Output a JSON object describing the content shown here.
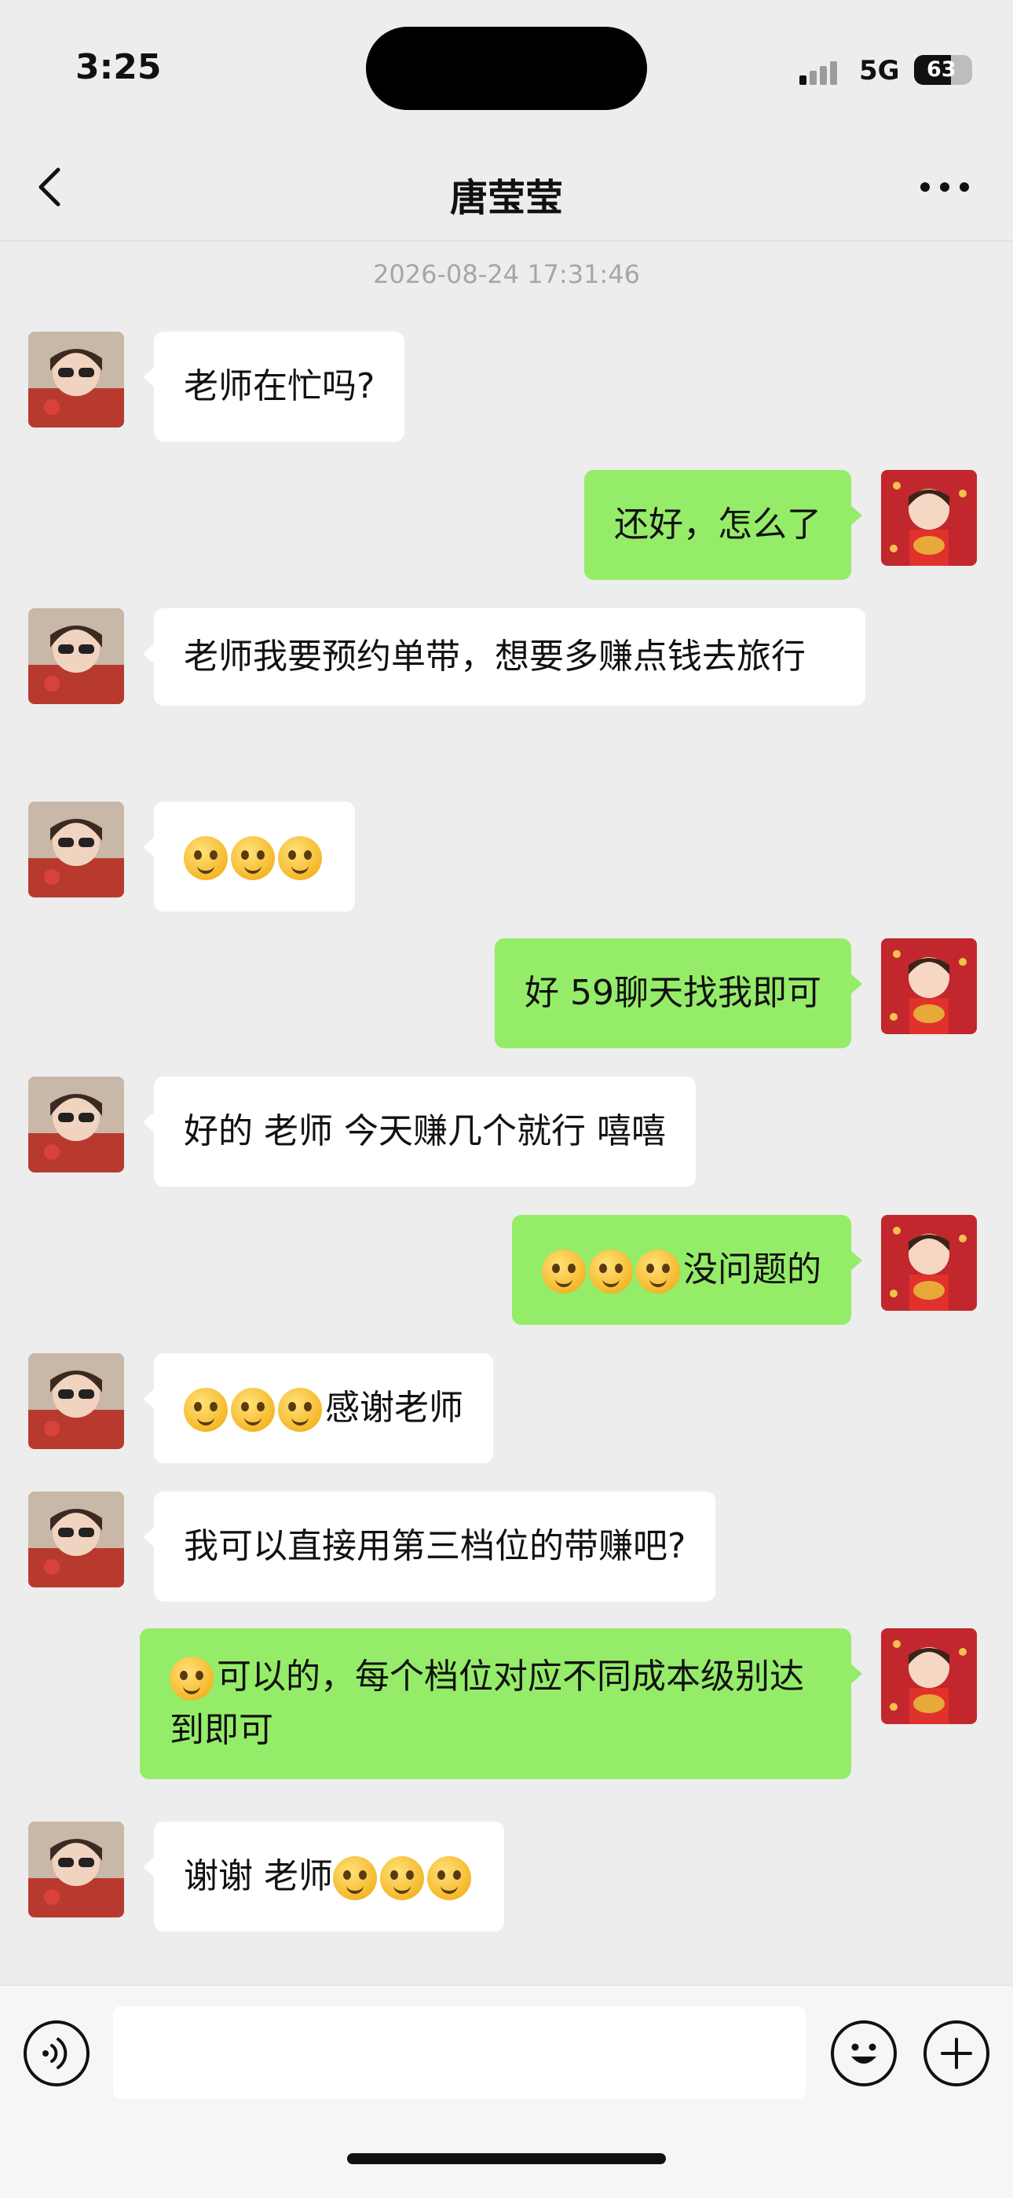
{
  "status_bar": {
    "time": "3:25",
    "network": "5G",
    "battery_percent": 63,
    "battery_label": "63",
    "signal_bars": 4
  },
  "nav": {
    "title": "唐莹莹",
    "back_icon": "chevron-left-icon",
    "more_icon": "more-dots-icon"
  },
  "chat": {
    "timestamp": "2026-08-24 17:31:46",
    "messages": [
      {
        "side": "in",
        "text": "老师在忙吗?"
      },
      {
        "side": "out",
        "text": "还好，怎么了"
      },
      {
        "side": "in",
        "text": "老师我要预约单带，想要多赚点钱去旅行"
      },
      {
        "side": "in",
        "emoji": "salute-face-emoji",
        "emoji_count": 3,
        "text": ""
      },
      {
        "side": "out",
        "text": "好 59聊天找我即可"
      },
      {
        "side": "in",
        "text": "好的 老师 今天赚几个就行 嘻嘻"
      },
      {
        "side": "out",
        "emoji": "smirk-face-emoji",
        "emoji_count": 3,
        "text": "没问题的"
      },
      {
        "side": "in",
        "emoji": "fighting-face-emoji",
        "emoji_count": 3,
        "text": "感谢老师"
      },
      {
        "side": "in",
        "text": "我可以直接用第三档位的带赚吧?"
      },
      {
        "side": "out",
        "emoji": "ok-hand-emoji",
        "emoji_count": 1,
        "text": "可以的，每个档位对应不同成本级别达到即可"
      },
      {
        "side": "in",
        "text": "谢谢 老师",
        "emoji_after": "grin-face-emoji",
        "emoji_after_count": 3
      }
    ]
  },
  "input_bar": {
    "voice_icon": "voice-icon",
    "emoji_icon": "emoji-face-icon",
    "plus_icon": "plus-circle-icon",
    "placeholder": ""
  },
  "colors": {
    "background": "#ededed",
    "incoming_bubble": "#ffffff",
    "outgoing_bubble": "#95ec69",
    "timestamp": "#a6a6a6"
  }
}
